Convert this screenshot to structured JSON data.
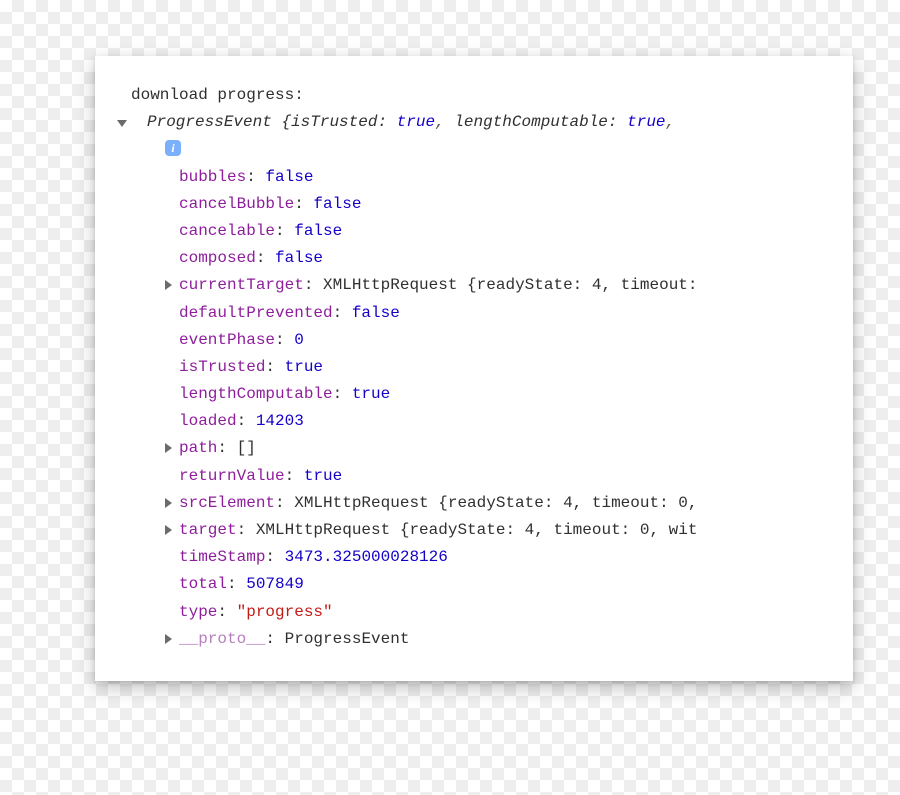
{
  "header_text": "download progress:",
  "summary": {
    "class_name": "ProgressEvent",
    "brace_open": "{",
    "items": [
      {
        "key": "isTrusted",
        "value": "true",
        "vclass": "v-blue"
      },
      {
        "key": "lengthComputable",
        "value": "true",
        "vclass": "v-blue"
      }
    ],
    "trailing": ","
  },
  "info_glyph": "i",
  "props": [
    {
      "key": "bubbles",
      "kclass": "k-purple",
      "value": "false",
      "vclass": "v-blue",
      "expandable": false
    },
    {
      "key": "cancelBubble",
      "kclass": "k-purple",
      "value": "false",
      "vclass": "v-blue",
      "expandable": false
    },
    {
      "key": "cancelable",
      "kclass": "k-purple",
      "value": "false",
      "vclass": "v-blue",
      "expandable": false
    },
    {
      "key": "composed",
      "kclass": "k-purple",
      "value": "false",
      "vclass": "v-blue",
      "expandable": false
    },
    {
      "key": "currentTarget",
      "kclass": "k-purple",
      "value": "XMLHttpRequest {readyState: 4, timeout:",
      "vclass": "v-black",
      "expandable": true
    },
    {
      "key": "defaultPrevented",
      "kclass": "k-purple",
      "value": "false",
      "vclass": "v-blue",
      "expandable": false
    },
    {
      "key": "eventPhase",
      "kclass": "k-purple",
      "value": "0",
      "vclass": "v-blue",
      "expandable": false
    },
    {
      "key": "isTrusted",
      "kclass": "k-purple",
      "value": "true",
      "vclass": "v-blue",
      "expandable": false
    },
    {
      "key": "lengthComputable",
      "kclass": "k-purple",
      "value": "true",
      "vclass": "v-blue",
      "expandable": false
    },
    {
      "key": "loaded",
      "kclass": "k-purple",
      "value": "14203",
      "vclass": "v-blue",
      "expandable": false
    },
    {
      "key": "path",
      "kclass": "k-purple",
      "value": "[]",
      "vclass": "v-black",
      "expandable": true
    },
    {
      "key": "returnValue",
      "kclass": "k-purple",
      "value": "true",
      "vclass": "v-blue",
      "expandable": false
    },
    {
      "key": "srcElement",
      "kclass": "k-purple",
      "value": "XMLHttpRequest {readyState: 4, timeout: 0,",
      "vclass": "v-black",
      "expandable": true
    },
    {
      "key": "target",
      "kclass": "k-purple",
      "value": "XMLHttpRequest {readyState: 4, timeout: 0, wit",
      "vclass": "v-black",
      "expandable": true
    },
    {
      "key": "timeStamp",
      "kclass": "k-purple",
      "value": "3473.325000028126",
      "vclass": "v-blue",
      "expandable": false
    },
    {
      "key": "total",
      "kclass": "k-purple",
      "value": "507849",
      "vclass": "v-blue",
      "expandable": false
    },
    {
      "key": "type",
      "kclass": "k-purple",
      "value": "\"progress\"",
      "vclass": "v-red",
      "expandable": false
    },
    {
      "key": "__proto__",
      "kclass": "k-pale",
      "value": "ProgressEvent",
      "vclass": "v-black",
      "expandable": true
    }
  ]
}
